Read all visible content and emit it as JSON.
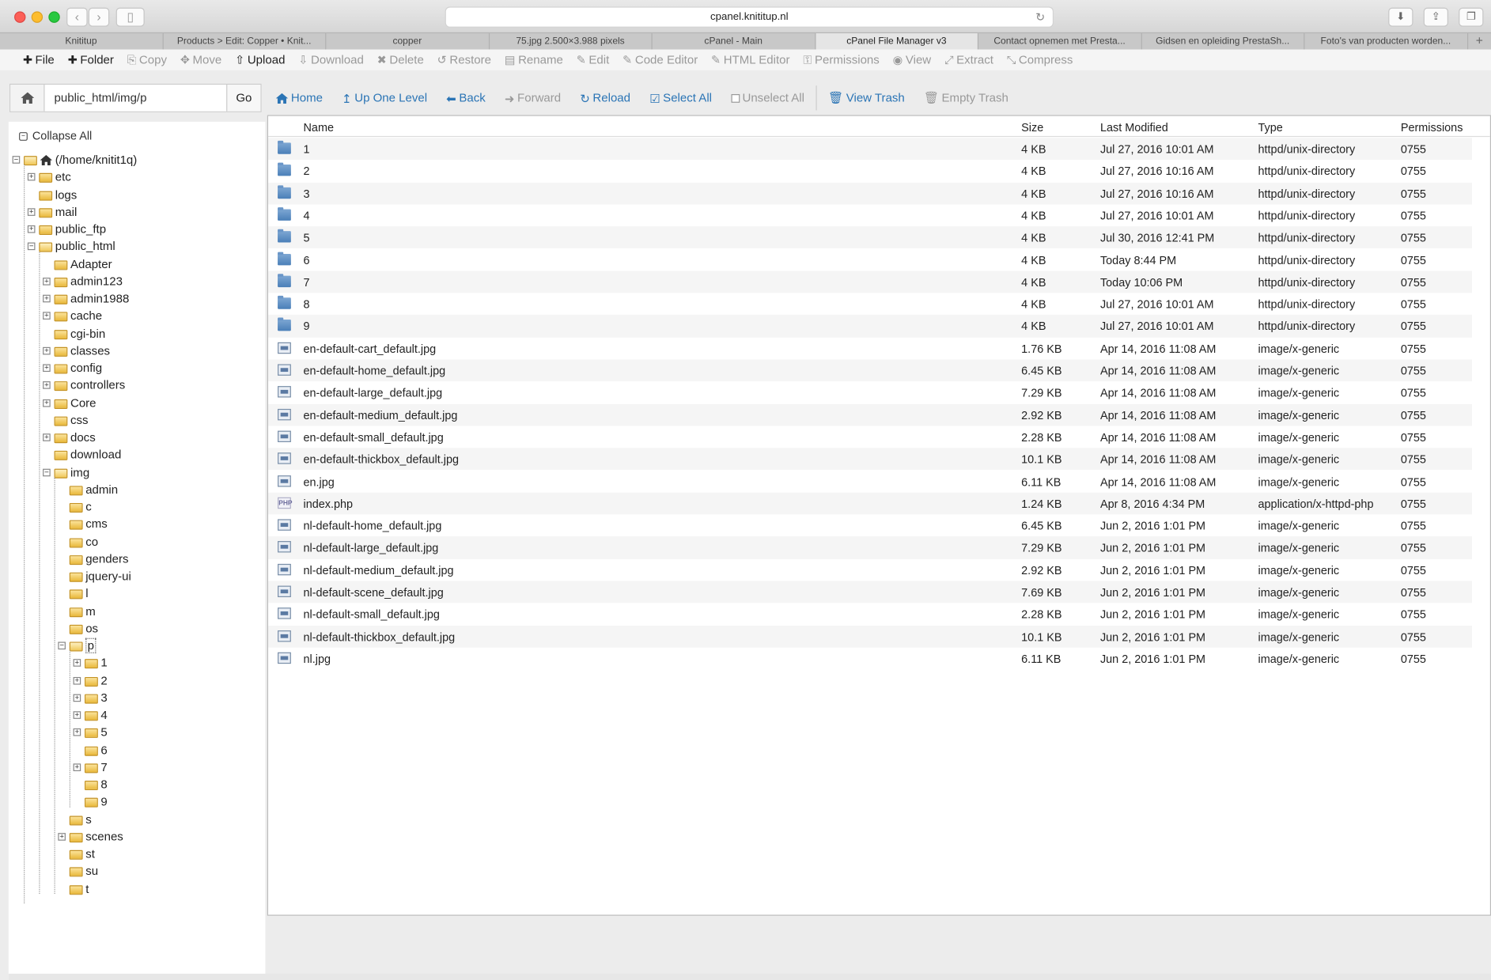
{
  "browser": {
    "url": "cpanel.knititup.nl",
    "tabs": [
      {
        "label": "Knititup",
        "active": false
      },
      {
        "label": "Products > Edit: Copper • Knit...",
        "active": false
      },
      {
        "label": "copper",
        "active": false
      },
      {
        "label": "75.jpg 2.500×3.988 pixels",
        "active": false
      },
      {
        "label": "cPanel - Main",
        "active": false
      },
      {
        "label": "cPanel File Manager v3",
        "active": true
      },
      {
        "label": "Contact opnemen met Presta...",
        "active": false
      },
      {
        "label": "Gidsen en opleiding PrestaSh...",
        "active": false
      },
      {
        "label": "Foto's van producten worden...",
        "active": false
      }
    ],
    "new_tab": "+"
  },
  "toolbar": {
    "file": "File",
    "folder": "Folder",
    "copy": "Copy",
    "move": "Move",
    "upload": "Upload",
    "download": "Download",
    "delete": "Delete",
    "restore": "Restore",
    "rename": "Rename",
    "edit": "Edit",
    "code_editor": "Code Editor",
    "html_editor": "HTML Editor",
    "permissions": "Permissions",
    "view": "View",
    "extract": "Extract",
    "compress": "Compress"
  },
  "path": {
    "value": "public_html/img/p",
    "go": "Go"
  },
  "actions": {
    "home": "Home",
    "up_one_level": "Up One Level",
    "back": "Back",
    "forward": "Forward",
    "reload": "Reload",
    "select_all": "Select All",
    "unselect_all": "Unselect All",
    "view_trash": "View Trash",
    "empty_trash": "Empty Trash"
  },
  "tree": {
    "collapse_all": "Collapse All",
    "root": "(/home/knitit1q)",
    "level1": [
      {
        "label": "etc",
        "expander": true
      },
      {
        "label": "logs",
        "expander": false
      },
      {
        "label": "mail",
        "expander": true
      },
      {
        "label": "public_ftp",
        "expander": true
      },
      {
        "label": "public_html",
        "expander": true
      }
    ],
    "public_html": [
      {
        "label": "Adapter",
        "expander": false
      },
      {
        "label": "admin123",
        "expander": true
      },
      {
        "label": "admin1988",
        "expander": true
      },
      {
        "label": "cache",
        "expander": true
      },
      {
        "label": "cgi-bin",
        "expander": false
      },
      {
        "label": "classes",
        "expander": true
      },
      {
        "label": "config",
        "expander": true
      },
      {
        "label": "controllers",
        "expander": true
      },
      {
        "label": "Core",
        "expander": true
      },
      {
        "label": "css",
        "expander": false
      },
      {
        "label": "docs",
        "expander": true
      },
      {
        "label": "download",
        "expander": false
      },
      {
        "label": "img",
        "expander": true
      }
    ],
    "img": [
      {
        "label": "admin",
        "expander": false
      },
      {
        "label": "c",
        "expander": false
      },
      {
        "label": "cms",
        "expander": false
      },
      {
        "label": "co",
        "expander": false
      },
      {
        "label": "genders",
        "expander": false
      },
      {
        "label": "jquery-ui",
        "expander": false
      },
      {
        "label": "l",
        "expander": false
      },
      {
        "label": "m",
        "expander": false
      },
      {
        "label": "os",
        "expander": false
      },
      {
        "label": "p",
        "expander": true
      }
    ],
    "p": [
      {
        "label": "1",
        "expander": true
      },
      {
        "label": "2",
        "expander": true
      },
      {
        "label": "3",
        "expander": true
      },
      {
        "label": "4",
        "expander": true
      },
      {
        "label": "5",
        "expander": true
      },
      {
        "label": "6",
        "expander": false
      },
      {
        "label": "7",
        "expander": true
      },
      {
        "label": "8",
        "expander": false
      },
      {
        "label": "9",
        "expander": false
      }
    ],
    "img_after": [
      {
        "label": "s",
        "expander": false
      },
      {
        "label": "scenes",
        "expander": true
      },
      {
        "label": "st",
        "expander": false
      },
      {
        "label": "su",
        "expander": false
      },
      {
        "label": "t",
        "expander": false
      }
    ]
  },
  "table": {
    "headers": {
      "name": "Name",
      "size": "Size",
      "modified": "Last Modified",
      "type": "Type",
      "perms": "Permissions"
    },
    "rows": [
      {
        "icon": "folder-icon",
        "name": "1",
        "size": "4 KB",
        "modified": "Jul 27, 2016 10:01 AM",
        "type": "httpd/unix-directory",
        "perms": "0755"
      },
      {
        "icon": "folder-icon",
        "name": "2",
        "size": "4 KB",
        "modified": "Jul 27, 2016 10:16 AM",
        "type": "httpd/unix-directory",
        "perms": "0755"
      },
      {
        "icon": "folder-icon",
        "name": "3",
        "size": "4 KB",
        "modified": "Jul 27, 2016 10:16 AM",
        "type": "httpd/unix-directory",
        "perms": "0755"
      },
      {
        "icon": "folder-icon",
        "name": "4",
        "size": "4 KB",
        "modified": "Jul 27, 2016 10:01 AM",
        "type": "httpd/unix-directory",
        "perms": "0755"
      },
      {
        "icon": "folder-icon",
        "name": "5",
        "size": "4 KB",
        "modified": "Jul 30, 2016 12:41 PM",
        "type": "httpd/unix-directory",
        "perms": "0755"
      },
      {
        "icon": "folder-icon",
        "name": "6",
        "size": "4 KB",
        "modified": "Today 8:44 PM",
        "type": "httpd/unix-directory",
        "perms": "0755"
      },
      {
        "icon": "folder-icon",
        "name": "7",
        "size": "4 KB",
        "modified": "Today 10:06 PM",
        "type": "httpd/unix-directory",
        "perms": "0755"
      },
      {
        "icon": "folder-icon",
        "name": "8",
        "size": "4 KB",
        "modified": "Jul 27, 2016 10:01 AM",
        "type": "httpd/unix-directory",
        "perms": "0755"
      },
      {
        "icon": "folder-icon",
        "name": "9",
        "size": "4 KB",
        "modified": "Jul 27, 2016 10:01 AM",
        "type": "httpd/unix-directory",
        "perms": "0755"
      },
      {
        "icon": "image-file-icon",
        "name": "en-default-cart_default.jpg",
        "size": "1.76 KB",
        "modified": "Apr 14, 2016 11:08 AM",
        "type": "image/x-generic",
        "perms": "0755"
      },
      {
        "icon": "image-file-icon",
        "name": "en-default-home_default.jpg",
        "size": "6.45 KB",
        "modified": "Apr 14, 2016 11:08 AM",
        "type": "image/x-generic",
        "perms": "0755"
      },
      {
        "icon": "image-file-icon",
        "name": "en-default-large_default.jpg",
        "size": "7.29 KB",
        "modified": "Apr 14, 2016 11:08 AM",
        "type": "image/x-generic",
        "perms": "0755"
      },
      {
        "icon": "image-file-icon",
        "name": "en-default-medium_default.jpg",
        "size": "2.92 KB",
        "modified": "Apr 14, 2016 11:08 AM",
        "type": "image/x-generic",
        "perms": "0755"
      },
      {
        "icon": "image-file-icon",
        "name": "en-default-small_default.jpg",
        "size": "2.28 KB",
        "modified": "Apr 14, 2016 11:08 AM",
        "type": "image/x-generic",
        "perms": "0755"
      },
      {
        "icon": "image-file-icon",
        "name": "en-default-thickbox_default.jpg",
        "size": "10.1 KB",
        "modified": "Apr 14, 2016 11:08 AM",
        "type": "image/x-generic",
        "perms": "0755"
      },
      {
        "icon": "image-file-icon",
        "name": "en.jpg",
        "size": "6.11 KB",
        "modified": "Apr 14, 2016 11:08 AM",
        "type": "image/x-generic",
        "perms": "0755"
      },
      {
        "icon": "php-file-icon",
        "name": "index.php",
        "size": "1.24 KB",
        "modified": "Apr 8, 2016 4:34 PM",
        "type": "application/x-httpd-php",
        "perms": "0755"
      },
      {
        "icon": "image-file-icon",
        "name": "nl-default-home_default.jpg",
        "size": "6.45 KB",
        "modified": "Jun 2, 2016 1:01 PM",
        "type": "image/x-generic",
        "perms": "0755"
      },
      {
        "icon": "image-file-icon",
        "name": "nl-default-large_default.jpg",
        "size": "7.29 KB",
        "modified": "Jun 2, 2016 1:01 PM",
        "type": "image/x-generic",
        "perms": "0755"
      },
      {
        "icon": "image-file-icon",
        "name": "nl-default-medium_default.jpg",
        "size": "2.92 KB",
        "modified": "Jun 2, 2016 1:01 PM",
        "type": "image/x-generic",
        "perms": "0755"
      },
      {
        "icon": "image-file-icon",
        "name": "nl-default-scene_default.jpg",
        "size": "7.69 KB",
        "modified": "Jun 2, 2016 1:01 PM",
        "type": "image/x-generic",
        "perms": "0755"
      },
      {
        "icon": "image-file-icon",
        "name": "nl-default-small_default.jpg",
        "size": "2.28 KB",
        "modified": "Jun 2, 2016 1:01 PM",
        "type": "image/x-generic",
        "perms": "0755"
      },
      {
        "icon": "image-file-icon",
        "name": "nl-default-thickbox_default.jpg",
        "size": "10.1 KB",
        "modified": "Jun 2, 2016 1:01 PM",
        "type": "image/x-generic",
        "perms": "0755"
      },
      {
        "icon": "image-file-icon",
        "name": "nl.jpg",
        "size": "6.11 KB",
        "modified": "Jun 2, 2016 1:01 PM",
        "type": "image/x-generic",
        "perms": "0755"
      }
    ]
  },
  "colors": {
    "link": "#2a74b5",
    "folder_blue": "#4a7fb8",
    "folder_yellow": "#e9b93c",
    "row_alt": "#f5f5f5"
  }
}
